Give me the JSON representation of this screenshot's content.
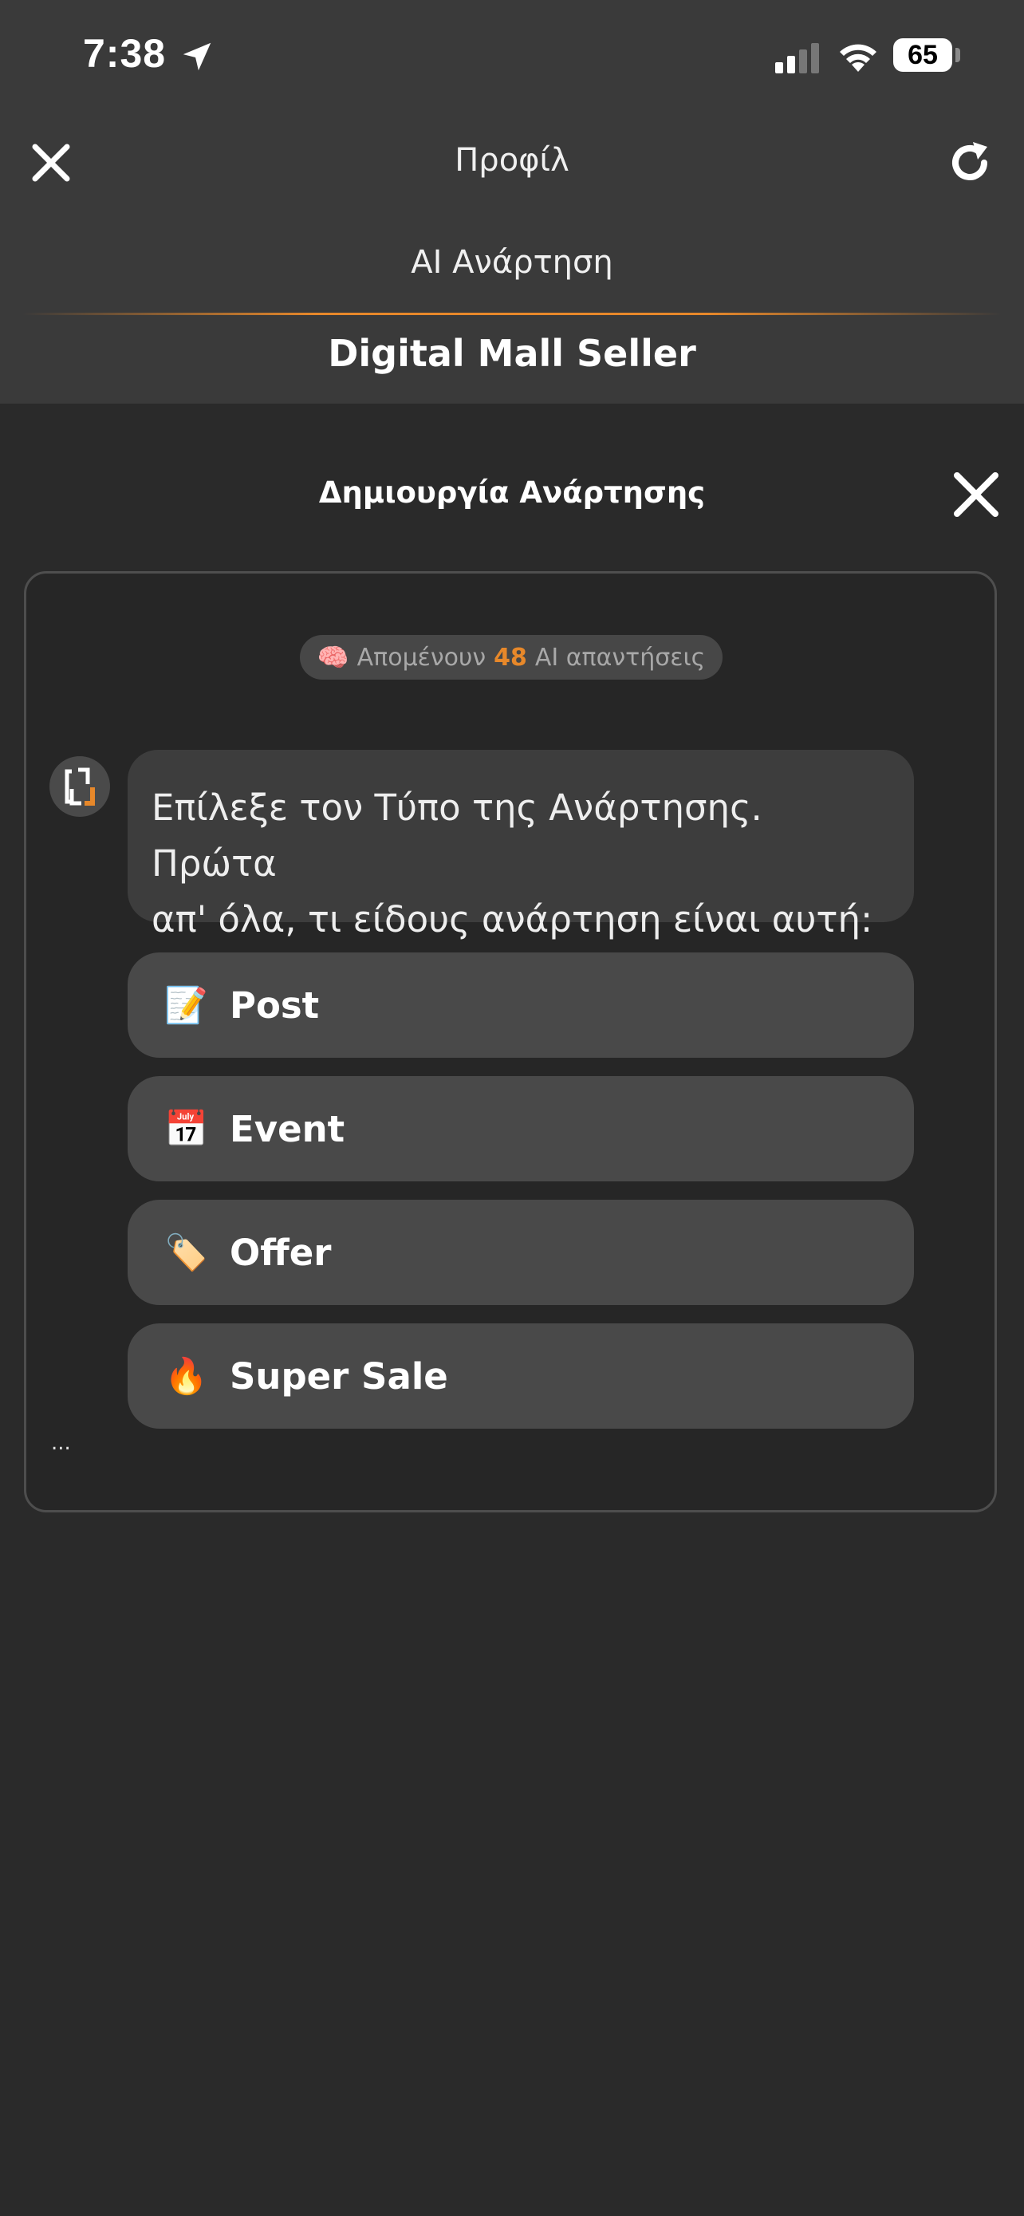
{
  "status_bar": {
    "time": "7:38",
    "battery": "65",
    "icons": [
      "location-arrow-icon",
      "cellular-signal-icon",
      "wifi-icon",
      "battery-icon"
    ]
  },
  "header": {
    "title": "Προφίλ",
    "subtitle": "AI Ανάρτηση",
    "seller_name": "Digital Mall Seller",
    "accent_color": "#e7882a"
  },
  "modal": {
    "title": "Δημιουργία Ανάρτησης"
  },
  "ai_credits": {
    "emoji": "🧠",
    "prefix": "Απομένουν",
    "count": "48",
    "suffix": "AI απαντήσεις"
  },
  "chat": {
    "message_line1": "Επίλεξε τον Τύπο της Ανάρτησης. Πρώτα",
    "message_line2": "απ' όλα, τι είδους ανάρτηση είναι αυτή:",
    "typing_indicator": "...",
    "options": [
      {
        "emoji": "📝",
        "label": "Post"
      },
      {
        "emoji": "📅",
        "label": "Event"
      },
      {
        "emoji": "🏷️",
        "label": "Offer"
      },
      {
        "emoji": "🔥",
        "label": "Super Sale"
      }
    ]
  }
}
